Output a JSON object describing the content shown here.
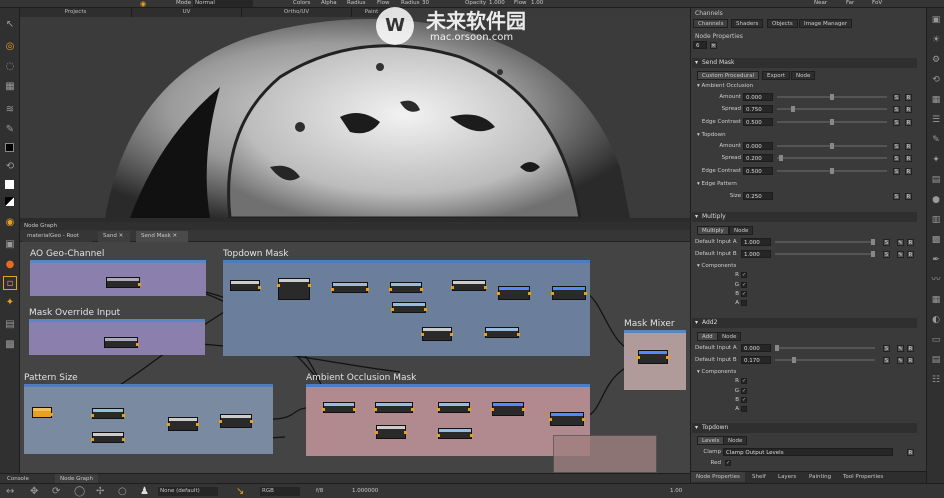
{
  "topbar": {
    "mode_label": "Mode",
    "mode_value": "Normal",
    "colors_label": "Colors",
    "alpha_label": "Alpha",
    "radius_label": "Radius",
    "flow_label": "Flow",
    "radius_value_label": "Radius",
    "radius_value": "30",
    "opacity_label": "Opacity",
    "opacity_value": "1.000",
    "flow_value_label": "Flow",
    "flow_value": "1.00",
    "near_label": "Near",
    "far_label": "Far",
    "fov_label": "FoV"
  },
  "watermark": {
    "brand": "未来软件园",
    "url": "mac.orsoon.com"
  },
  "viewport": {
    "tabs": [
      "Projects",
      "UV",
      "Ortho/UV",
      "Paint"
    ]
  },
  "node_graph": {
    "title": "Node Graph",
    "tabs": [
      "materialGeo - Root",
      "Sand",
      "Send Mask"
    ],
    "backdrops": [
      {
        "title": "AO Geo-Channel"
      },
      {
        "title": "Topdown Mask"
      },
      {
        "title": "Mask Override Input"
      },
      {
        "title": "Mask Mixer"
      },
      {
        "title": "Pattern Size"
      },
      {
        "title": "Ambient Occlusion Mask"
      }
    ]
  },
  "bottom_tabs": [
    "Console",
    "Node Graph"
  ],
  "statusbar": {
    "layer_mode": "None (default)",
    "color_mode": "RGB",
    "fstop": "f/8",
    "gain": "1.000000",
    "zoom": "1.00"
  },
  "right_panel": {
    "channels_header": "Channels",
    "top_tabs": [
      "Channels",
      "Shaders",
      "Objects",
      "Image Manager"
    ],
    "node_properties_header": "Node Properties",
    "node_count": "6",
    "send_mask": {
      "title": "Send Mask",
      "tabs": [
        "Custom Procedural",
        "Export",
        "Node"
      ],
      "ambient_occlusion": {
        "title": "Ambient Occlusion",
        "rows": [
          {
            "label": "Amount",
            "value": "0.000",
            "fraction": 0.5
          },
          {
            "label": "Spread",
            "value": "0.750",
            "fraction": 0.15
          },
          {
            "label": "Edge Contrast",
            "value": "0.500",
            "fraction": 0.5
          }
        ]
      },
      "topdown": {
        "title": "Topdown",
        "rows": [
          {
            "label": "Amount",
            "value": "0.000",
            "fraction": 0.5
          },
          {
            "label": "Spread",
            "value": "0.200",
            "fraction": 0.02
          },
          {
            "label": "Edge Contrast",
            "value": "0.500",
            "fraction": 0.5
          }
        ]
      },
      "edge_pattern": {
        "title": "Edge Pattern",
        "rows": [
          {
            "label": "Size",
            "value": "0.250"
          }
        ]
      }
    },
    "multiply": {
      "title": "Multiply",
      "tabs": [
        "Multiply",
        "Node"
      ],
      "rows": [
        {
          "label": "Default Input A",
          "value": "1.000",
          "fraction": 1.0
        },
        {
          "label": "Default Input B",
          "value": "1.000",
          "fraction": 1.0
        }
      ],
      "components_title": "Components",
      "components": [
        "R",
        "G",
        "B",
        "A"
      ]
    },
    "add": {
      "title": "Add2",
      "tabs": [
        "Add",
        "Node"
      ],
      "rows": [
        {
          "label": "Default Input A",
          "value": "0.000",
          "fraction": 0.0
        },
        {
          "label": "Default Input B",
          "value": "0.170",
          "fraction": 0.17
        }
      ],
      "components_title": "Components",
      "components": [
        "R",
        "G",
        "B",
        "A"
      ]
    },
    "topdown_node": {
      "title": "Topdown",
      "tabs": [
        "Levels",
        "Node"
      ],
      "clamp_label": "Clamp",
      "clamp_value": "Clamp Output Levels",
      "red_label": "Red"
    },
    "bottom_tabs": [
      "Node Properties",
      "Shelf",
      "Layers",
      "Painting",
      "Tool Properties"
    ]
  },
  "colors": {
    "accent": "#e8a020",
    "backdrop_blue": "#6a8fbf",
    "backdrop_purple": "#9a8bb8",
    "backdrop_red": "#b88888"
  }
}
